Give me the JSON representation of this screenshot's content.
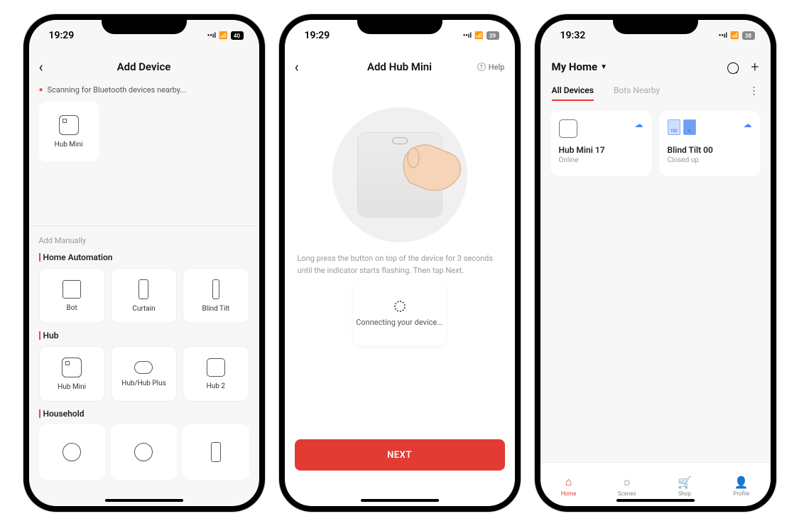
{
  "phone1": {
    "status": {
      "time": "19:29",
      "battery": "40"
    },
    "title": "Add Device",
    "scan_text": "Scanning for Bluetooth devices nearby...",
    "found": [
      {
        "name": "Hub Mini"
      }
    ],
    "add_manually_label": "Add Manually",
    "categories": [
      {
        "title": "Home Automation",
        "items": [
          "Bot",
          "Curtain",
          "Blind Tilt"
        ]
      },
      {
        "title": "Hub",
        "items": [
          "Hub Mini",
          "Hub/Hub Plus",
          "Hub 2"
        ]
      },
      {
        "title": "Household",
        "items": [
          "",
          "",
          ""
        ]
      }
    ]
  },
  "phone2": {
    "status": {
      "time": "19:29",
      "battery": "39"
    },
    "title": "Add Hub Mini",
    "help_label": "Help",
    "instruction": "Long press the button on top of the device for 3 seconds until the indicator starts flashing. Then tap Next.",
    "connecting_text": "Connecting your device...",
    "next_label": "NEXT"
  },
  "phone3": {
    "status": {
      "time": "19:32",
      "battery": "38"
    },
    "home_title": "My Home",
    "tabs": [
      "All Devices",
      "Bots Nearby"
    ],
    "devices": [
      {
        "name": "Hub Mini 17",
        "status": "Online"
      },
      {
        "name": "Blind Tilt 00",
        "status": "Closed up",
        "badge1": "100",
        "badge2": "0"
      }
    ],
    "bottom": [
      "Home",
      "Scenes",
      "Shop",
      "Profile"
    ]
  }
}
